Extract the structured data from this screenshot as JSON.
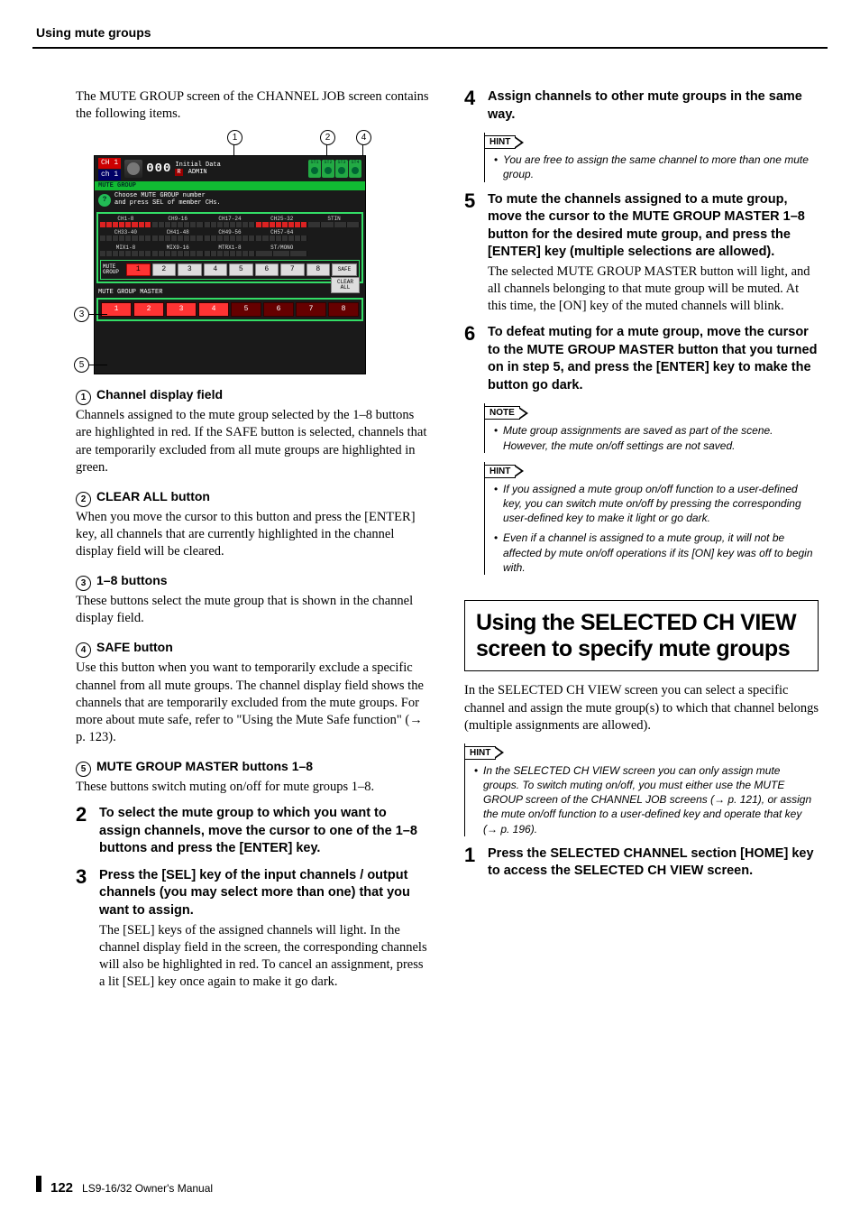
{
  "running_head": "Using mute groups",
  "footer": {
    "pagenum": "122",
    "manual": "LS9-16/32  Owner's Manual"
  },
  "left": {
    "intro": "The MUTE GROUP screen of the CHANNEL JOB screen contains the following items.",
    "callouts_top": {
      "c1": "1",
      "c2": "2",
      "c4": "4"
    },
    "callouts_side": {
      "c3": "3",
      "c5": "5"
    },
    "shot": {
      "ch_top": "CH 1",
      "ch_bot": "ch 1",
      "scene_no": "000",
      "scene_name": "Initial Data",
      "scene_sub1": "R",
      "scene_sub2": "ADMIN",
      "st_labels": [
        "ST1",
        "ST2",
        "ST3",
        "ST4"
      ],
      "greenbar": "MUTE GROUP",
      "help1": "Choose MUTE GROUP number",
      "help2": "and press SEL of member CHs.",
      "ch_rows": [
        [
          "CH1-8",
          "CH9-16",
          "CH17-24",
          "CH25-32",
          "STIN"
        ],
        [
          "CH33-40",
          "CH41-48",
          "CH49-56",
          "CH57-64",
          ""
        ],
        [
          "MIX1-8",
          "MIX9-16",
          "MTRX1-8",
          "ST/MONO",
          ""
        ]
      ],
      "mute_label": "MUTE\nGROUP",
      "mute_btns": [
        "1",
        "2",
        "3",
        "4",
        "5",
        "6",
        "7",
        "8"
      ],
      "safe": "SAFE",
      "clear_all": "CLEAR\nALL",
      "master_head": "MUTE GROUP MASTER",
      "master_btns": [
        "1",
        "2",
        "3",
        "4",
        "5",
        "6",
        "7",
        "8"
      ]
    },
    "items": [
      {
        "n": "1",
        "title": "Channel display field",
        "body": "Channels assigned to the mute group selected by the 1–8 buttons are highlighted in red. If the SAFE button is selected, channels that are temporarily excluded from all mute groups are highlighted in green."
      },
      {
        "n": "2",
        "title": "CLEAR ALL button",
        "body": "When you move the cursor to this button and press the [ENTER] key, all channels that are currently highlighted in the channel display field will be cleared."
      },
      {
        "n": "3",
        "title": "1–8 buttons",
        "body": "These buttons select the mute group that is shown in the channel display field."
      },
      {
        "n": "4",
        "title": "SAFE button",
        "body": "Use this button when you want to temporarily exclude a specific channel from all mute groups. The channel display field shows the channels that are temporarily excluded from the mute groups. For more about mute safe, refer to \"Using the Mute Safe function\" (→ p. 123)."
      },
      {
        "n": "5",
        "title": "MUTE GROUP MASTER buttons 1–8",
        "body": "These buttons switch muting on/off for mute groups 1–8."
      }
    ],
    "steps": [
      {
        "n": "2",
        "bold": "To select the mute group to which you want to assign channels, move the cursor to one of the 1–8 buttons and press the [ENTER] key.",
        "reg": ""
      },
      {
        "n": "3",
        "bold": "Press the [SEL] key of the input channels / output channels (you may select more than one) that you want to assign.",
        "reg": "The [SEL] keys of the assigned channels will light. In the channel display field in the screen, the corresponding channels will also be highlighted in red. To cancel an assignment, press a lit [SEL] key once again to make it go dark."
      }
    ]
  },
  "right": {
    "steps_a": [
      {
        "n": "4",
        "bold": "Assign channels to other mute groups in the same way.",
        "reg": ""
      }
    ],
    "hint1": {
      "tag": "HINT",
      "items": [
        "You are free to assign the same channel to more than one mute group."
      ]
    },
    "steps_b": [
      {
        "n": "5",
        "bold": "To mute the channels assigned to a mute group, move the cursor to the MUTE GROUP MASTER 1–8 button for the desired mute group, and press the [ENTER] key (multiple selections are allowed).",
        "reg": "The selected MUTE GROUP MASTER button will light, and all channels belonging to that mute group will be muted. At this time, the [ON] key of the muted channels will blink."
      },
      {
        "n": "6",
        "bold": "To defeat muting for a mute group, move the cursor to the MUTE GROUP MASTER button that you turned on in step 5, and press the [ENTER] key to make the button go dark.",
        "reg": ""
      }
    ],
    "note1": {
      "tag": "NOTE",
      "items": [
        "Mute group assignments are saved as part of the scene. However, the mute on/off settings are not saved."
      ]
    },
    "hint2": {
      "tag": "HINT",
      "items": [
        "If you assigned a mute group on/off function to a user-defined key, you can switch mute on/off by pressing the corresponding user-defined key to make it light or go dark.",
        "Even if a channel is assigned to a mute group, it will not be affected by mute on/off operations if its [ON] key was off to begin with."
      ]
    },
    "section_title": "Using the SELECTED CH VIEW screen to specify mute groups",
    "section_intro": "In the SELECTED CH VIEW screen you can select a specific channel and assign the mute group(s) to which that channel belongs (multiple assignments are allowed).",
    "hint3": {
      "tag": "HINT",
      "items": [
        "In the SELECTED CH VIEW screen you can only assign mute groups. To switch muting on/off, you must either use the MUTE GROUP screen of the CHANNEL JOB screens (→ p. 121), or assign the mute on/off function to a user-defined key and operate that key (→ p. 196)."
      ]
    },
    "steps_c": [
      {
        "n": "1",
        "bold": "Press the SELECTED CHANNEL section [HOME] key to access the SELECTED CH VIEW screen.",
        "reg": ""
      }
    ]
  }
}
